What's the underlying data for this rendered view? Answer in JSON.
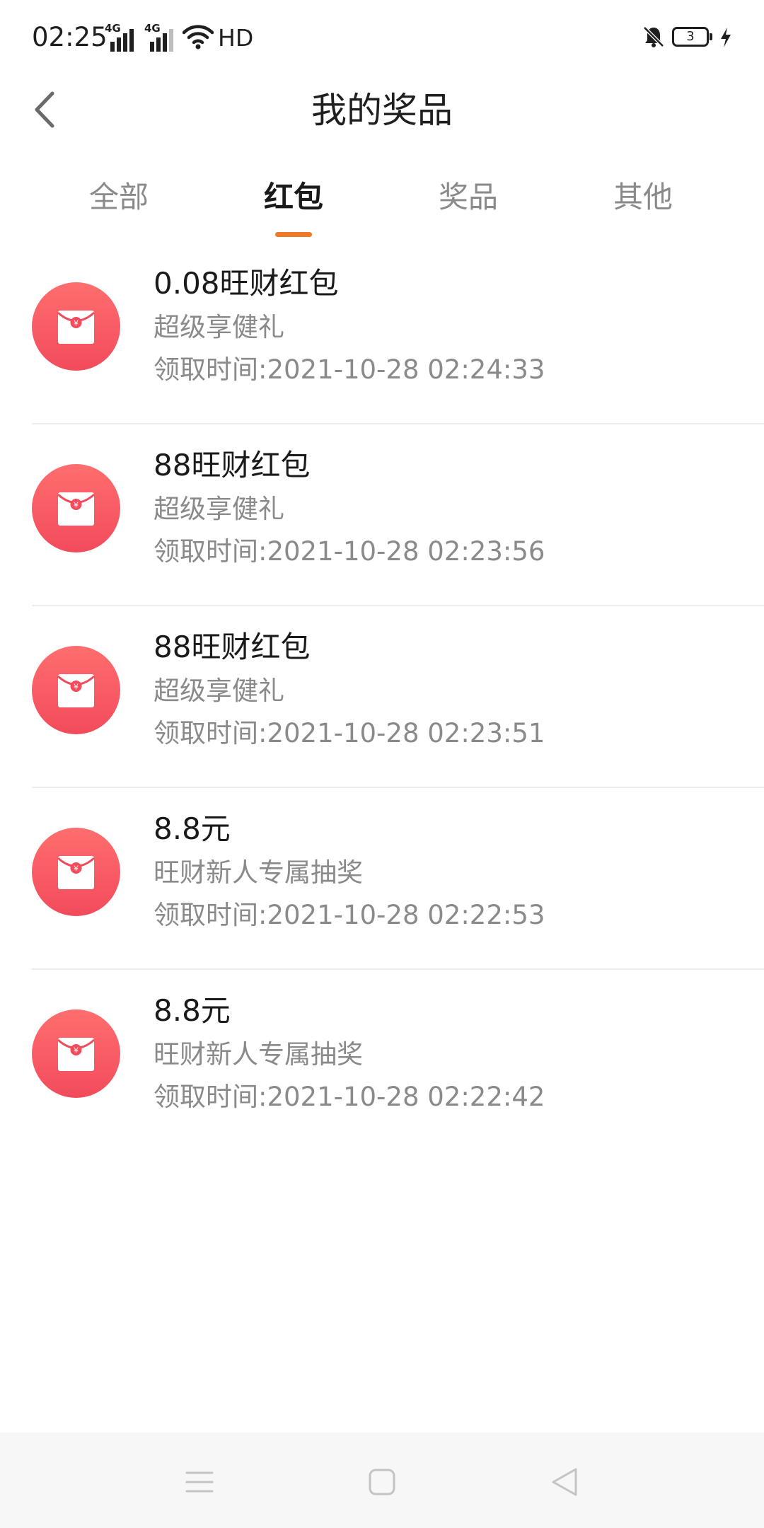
{
  "status_bar": {
    "time": "02:25",
    "signal1_label": "4G",
    "signal2_label": "4G",
    "hd_label": "HD",
    "battery_level": "3"
  },
  "header": {
    "title": "我的奖品",
    "back_icon": "chevron-left-icon"
  },
  "tabs": [
    {
      "label": "全部",
      "active": false
    },
    {
      "label": "红包",
      "active": true
    },
    {
      "label": "奖品",
      "active": false
    },
    {
      "label": "其他",
      "active": false
    }
  ],
  "items": [
    {
      "title": "0.08旺财红包",
      "subtitle": "超级享健礼",
      "time": "领取时间:2021-10-28 02:24:33",
      "icon": "red-envelope-icon"
    },
    {
      "title": "88旺财红包",
      "subtitle": "超级享健礼",
      "time": "领取时间:2021-10-28 02:23:56",
      "icon": "red-envelope-icon"
    },
    {
      "title": "88旺财红包",
      "subtitle": "超级享健礼",
      "time": "领取时间:2021-10-28 02:23:51",
      "icon": "red-envelope-icon"
    },
    {
      "title": "8.8元",
      "subtitle": "旺财新人专属抽奖",
      "time": "领取时间:2021-10-28 02:22:53",
      "icon": "red-envelope-icon"
    },
    {
      "title": "8.8元",
      "subtitle": "旺财新人专属抽奖",
      "time": "领取时间:2021-10-28 02:22:42",
      "icon": "red-envelope-icon"
    }
  ],
  "nav_bar": {
    "icons": [
      "menu-icon",
      "home-square-icon",
      "back-triangle-icon"
    ]
  },
  "colors": {
    "accent": "#f07a2a",
    "envelope_bg_top": "#ff6e6e",
    "envelope_bg_bottom": "#f24b5c",
    "text_primary": "#1a1a1a",
    "text_secondary": "#8a8a8a"
  }
}
